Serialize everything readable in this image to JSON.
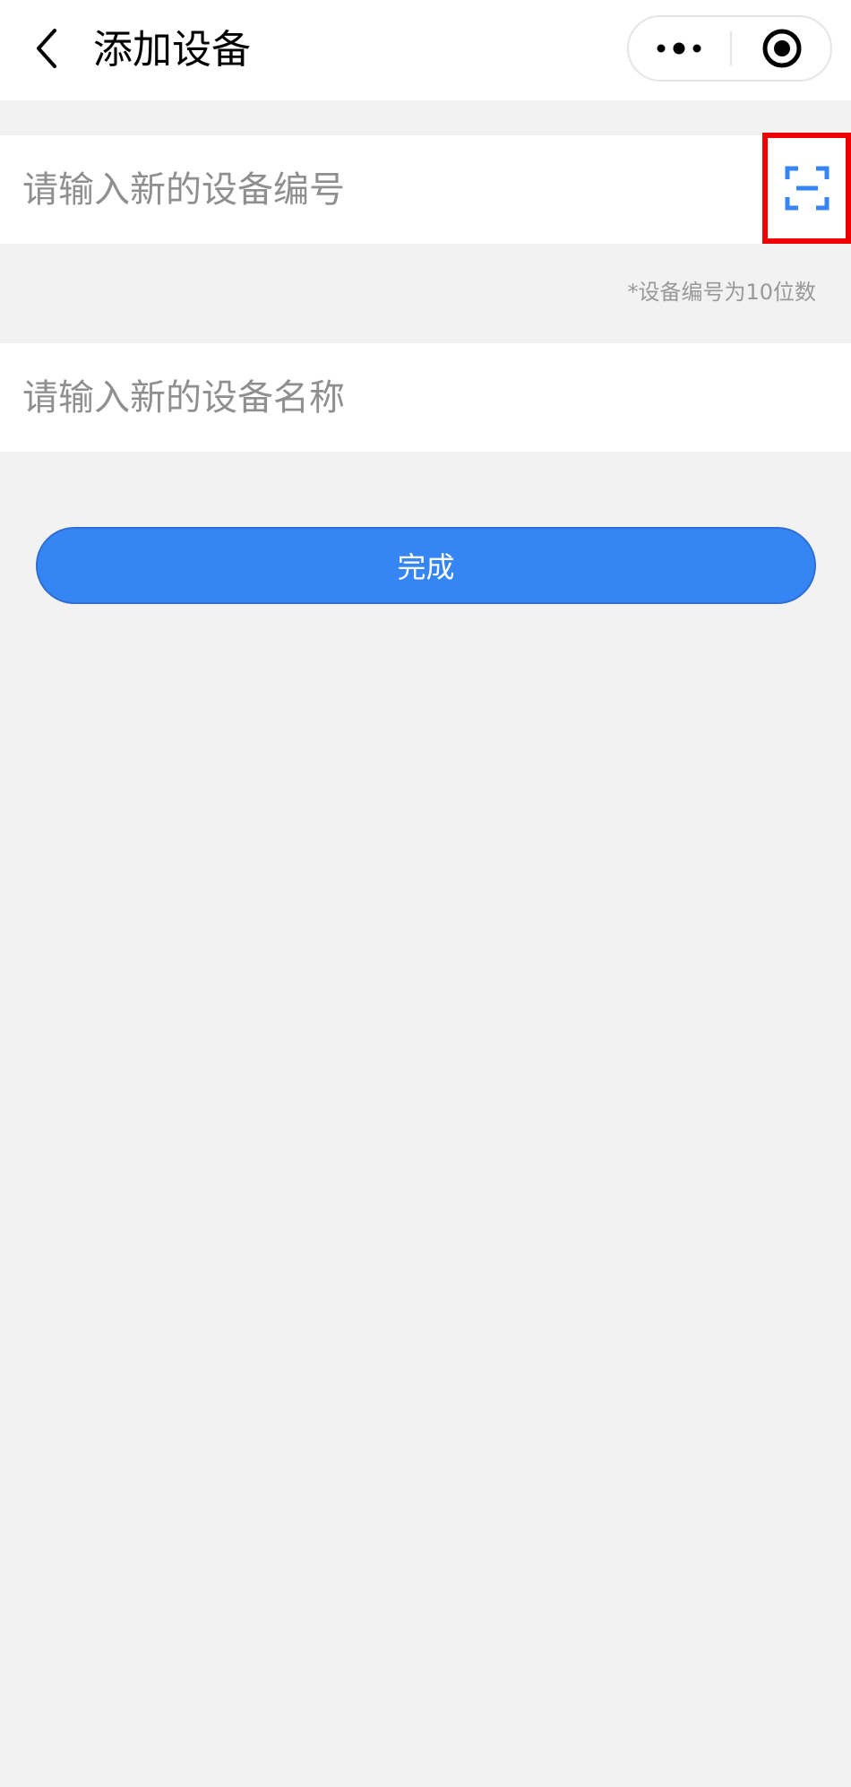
{
  "header": {
    "title": "添加设备",
    "back_icon": "chevron-left-icon",
    "more_icon": "more-dots-icon",
    "close_icon": "target-circle-icon"
  },
  "form": {
    "code_input": {
      "placeholder": "请输入新的设备编号",
      "value": ""
    },
    "scan_icon": "scan-icon",
    "code_hint": "*设备编号为10位数",
    "name_input": {
      "placeholder": "请输入新的设备名称",
      "value": ""
    },
    "submit_label": "完成"
  },
  "colors": {
    "accent": "#3585f5",
    "highlight_border": "#ee0000",
    "page_background": "#f2f2f2"
  }
}
